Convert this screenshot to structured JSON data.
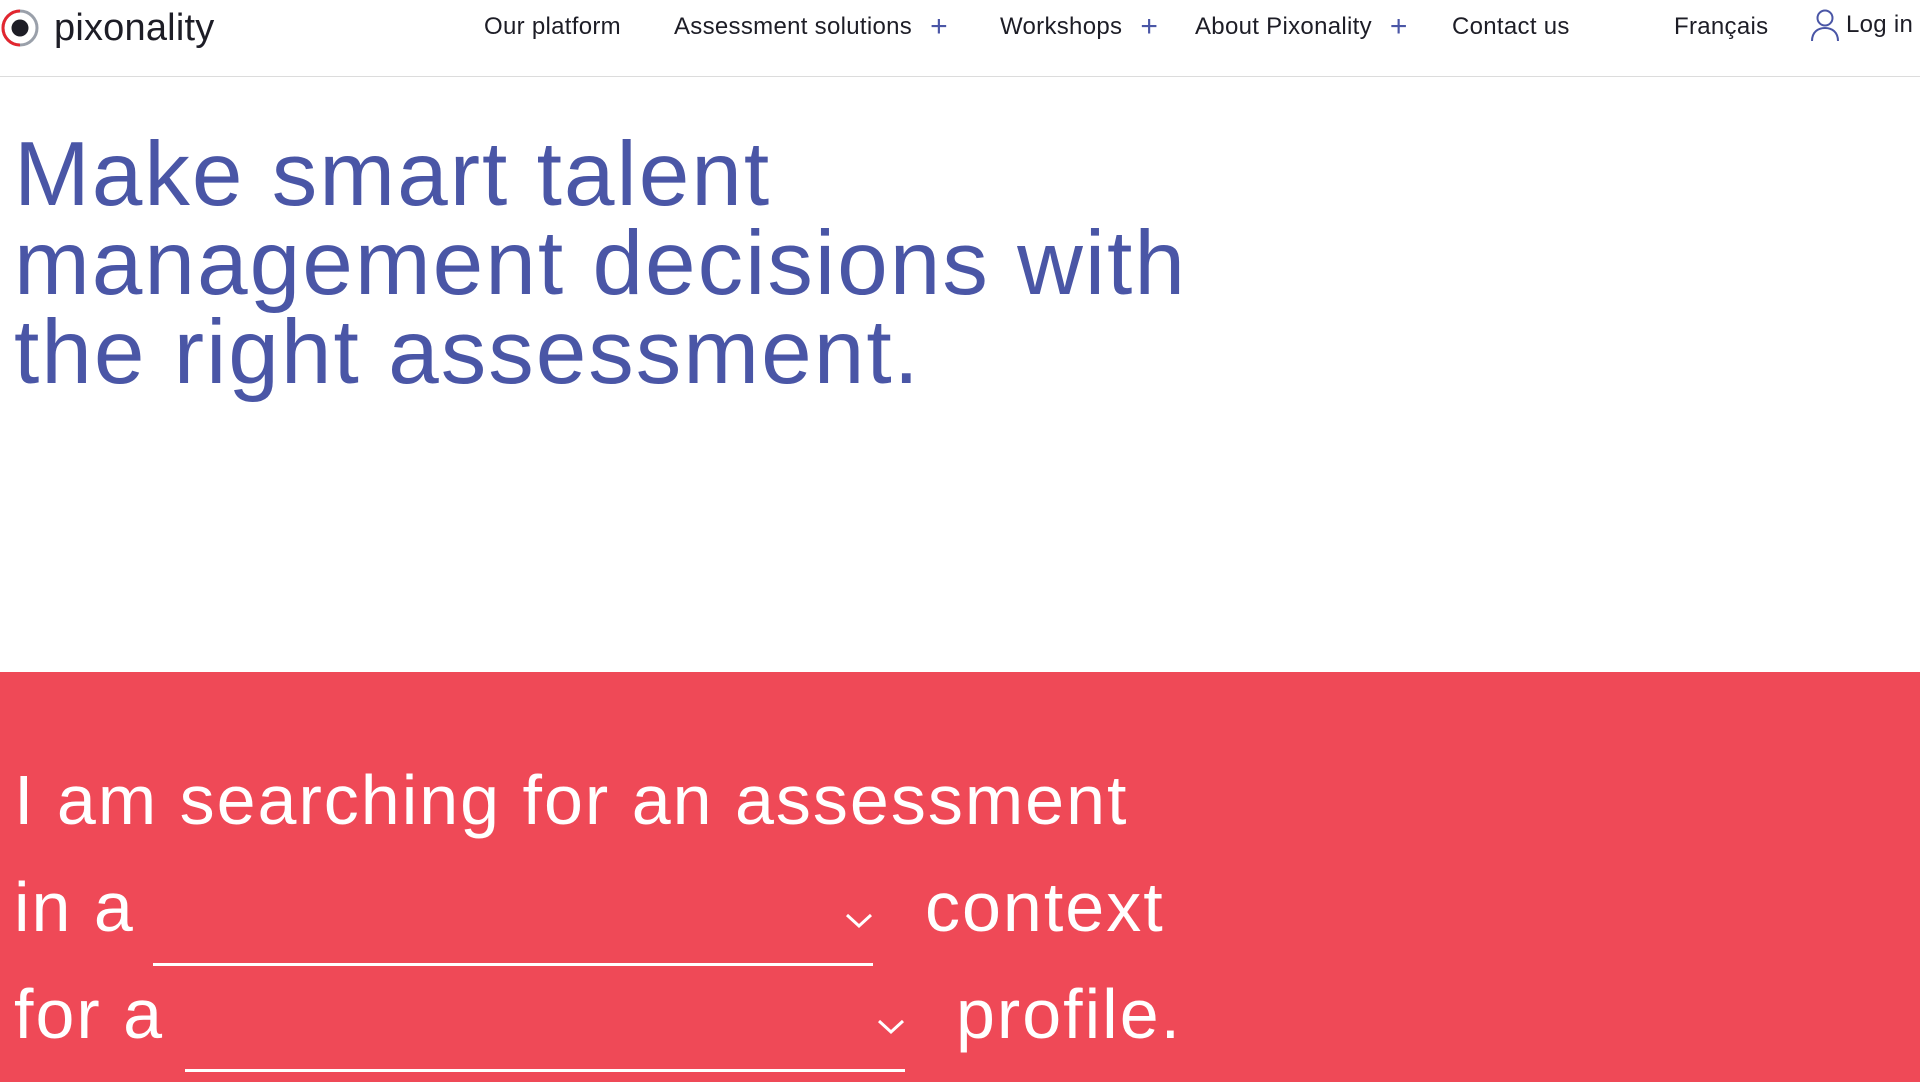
{
  "brand": {
    "name": "pixonality",
    "logo_icon": "pixonality-logo-icon",
    "colors": {
      "primary": "#4a56a6",
      "accent": "#ef4957",
      "logo_red": "#e3262f",
      "logo_gray": "#9aa0aa"
    }
  },
  "nav": {
    "items": [
      {
        "label": "Our platform",
        "expandable": false
      },
      {
        "label": "Assessment solutions",
        "expandable": true
      },
      {
        "label": "Workshops",
        "expandable": true
      },
      {
        "label": "About Pixonality",
        "expandable": true
      },
      {
        "label": "Contact us",
        "expandable": false
      }
    ],
    "expand_icon": "plus-icon",
    "language": "Français",
    "login_label": "Log in",
    "login_icon": "user-icon"
  },
  "hero": {
    "title_lines": [
      "Make smart talent",
      "management decisions with",
      "the right assessment."
    ]
  },
  "finder": {
    "line1": "I am searching for an assessment",
    "line2_prefix": "in a",
    "line2_suffix": "context",
    "line3_prefix": "for a",
    "line3_suffix": "profile.",
    "context_select_value": "",
    "profile_select_value": "",
    "select_icon": "chevron-down-icon"
  }
}
